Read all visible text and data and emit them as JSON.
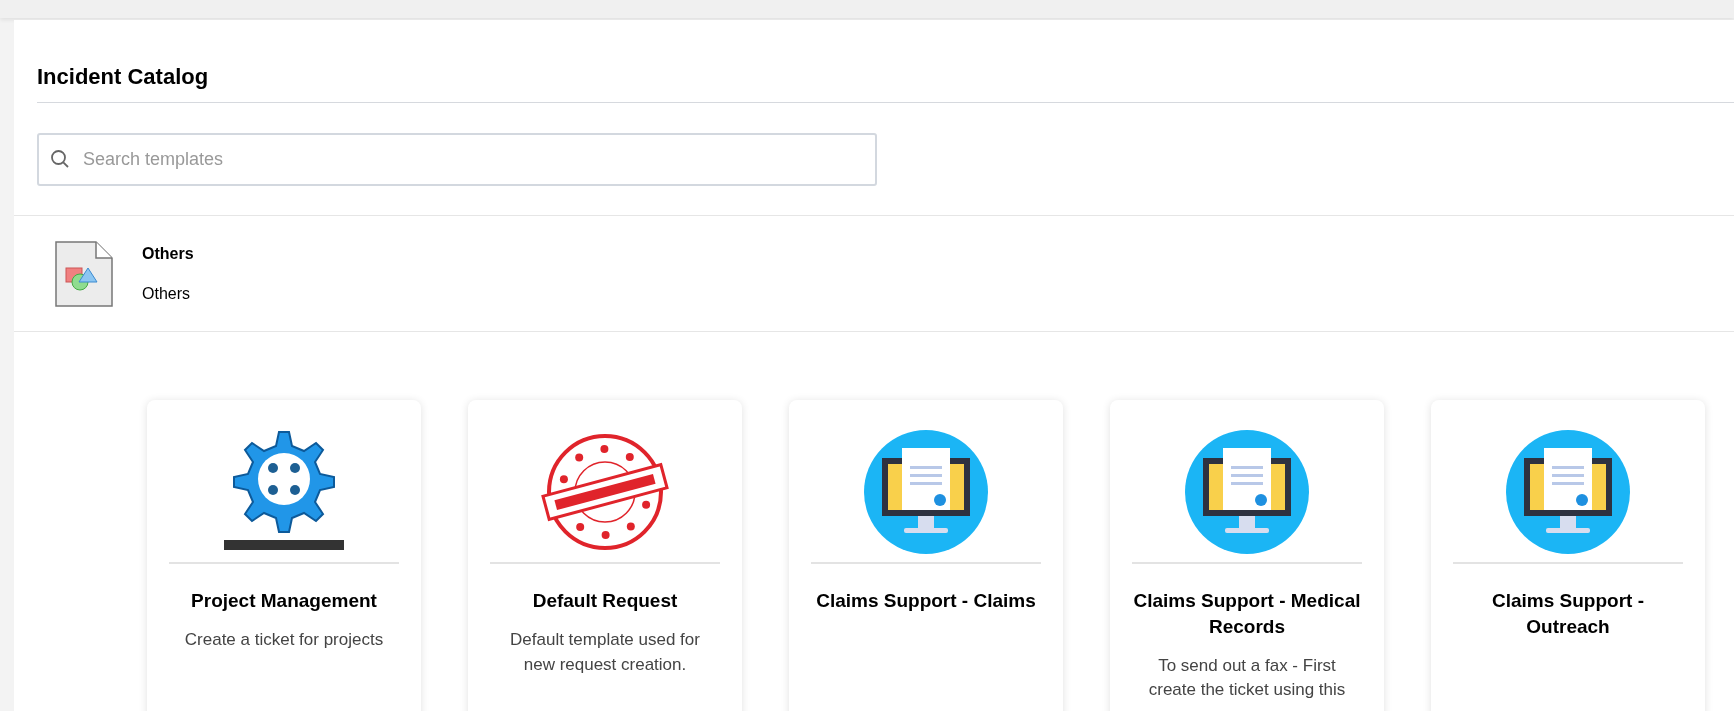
{
  "title": "Incident Catalog",
  "search": {
    "placeholder": "Search templates"
  },
  "category": {
    "name": "Others",
    "description": "Others"
  },
  "templates": [
    {
      "title": "Project Management",
      "description": "Create a ticket for projects"
    },
    {
      "title": "Default Request",
      "description": "Default template used for new request creation."
    },
    {
      "title": "Claims Support - Claims"
    },
    {
      "title": "Claims Support - Medical Records",
      "description": "To send out a fax - First create the ticket using this"
    },
    {
      "title": "Claims Support - Outreach"
    }
  ]
}
